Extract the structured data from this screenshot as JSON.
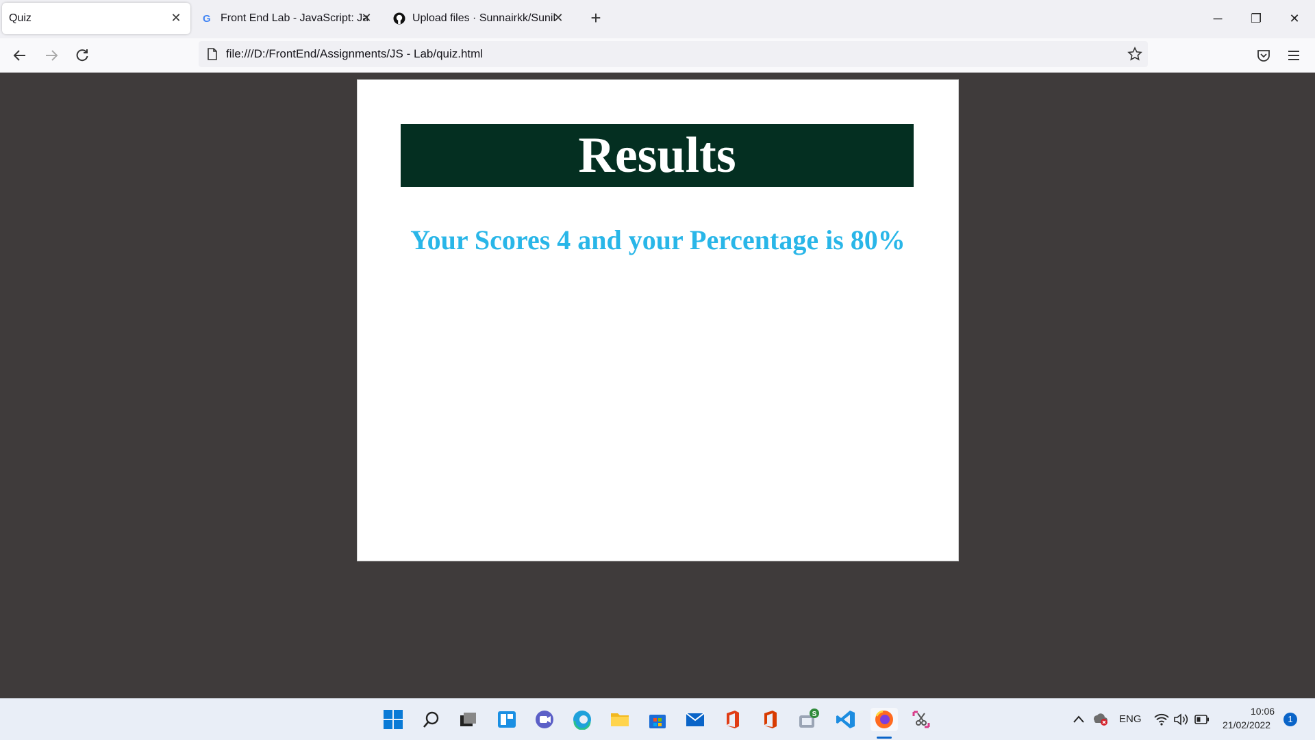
{
  "browser": {
    "tabs": [
      {
        "title": "Quiz",
        "active": true
      },
      {
        "title": "Front End Lab - JavaScript: Java",
        "active": false
      },
      {
        "title": "Upload files · Sunnairkk/SunilK",
        "active": false
      }
    ],
    "url": "file:///D:/FrontEnd/Assignments/JS - Lab/quiz.html"
  },
  "page": {
    "heading": "Results",
    "score_text": "Your Scores 4 and your Percentage is 80%"
  },
  "taskbar": {
    "language": "ENG",
    "time": "10:06",
    "date": "21/02/2022",
    "notification_count": "1",
    "badge": "S"
  },
  "colors": {
    "results_bg": "#042f21",
    "score_text": "#29b6e8",
    "content_bg": "#3f3b3b"
  }
}
